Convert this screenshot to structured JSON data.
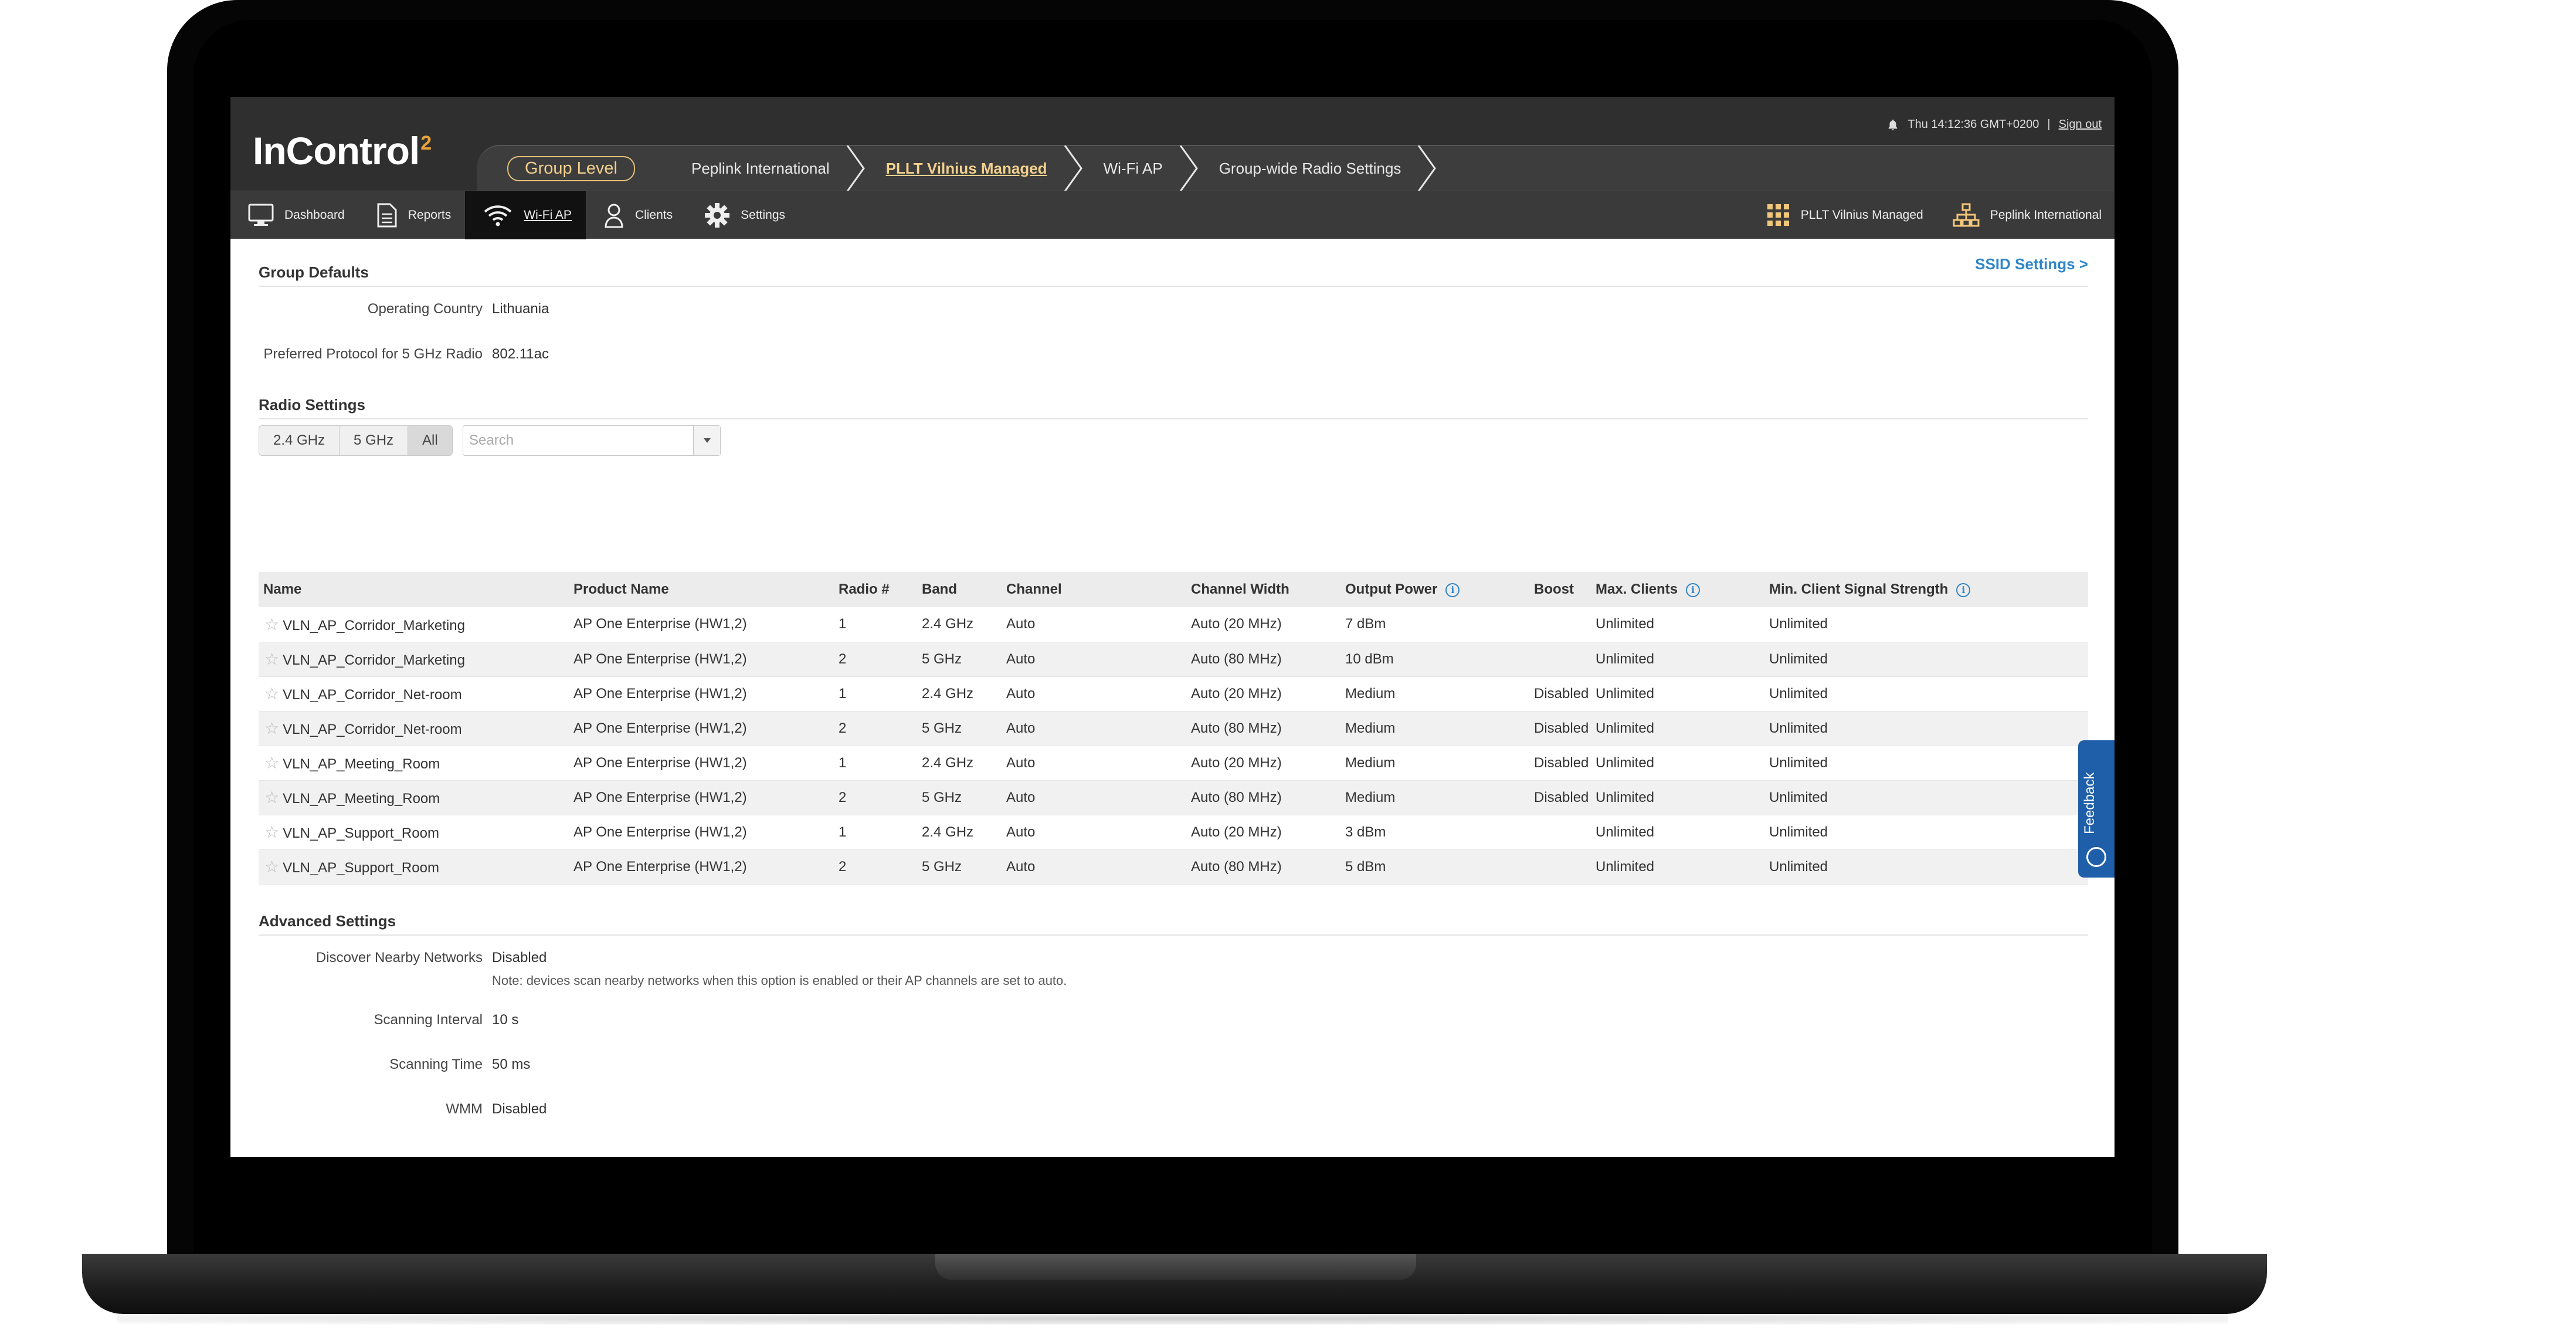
{
  "header": {
    "logo_text": "InControl",
    "logo_sup": "2",
    "datetime": "Thu 14:12:36 GMT+0200",
    "divider": "|",
    "sign_out": "Sign out"
  },
  "breadcrumb": {
    "group_level": "Group Level",
    "items": [
      "Peplink International",
      "PLLT Vilnius Managed",
      "Wi-Fi AP",
      "Group-wide Radio Settings"
    ]
  },
  "nav": {
    "items": [
      "Dashboard",
      "Reports",
      "Wi-Fi AP",
      "Clients",
      "Settings"
    ],
    "right": [
      "PLLT Vilnius Managed",
      "Peplink International"
    ]
  },
  "group_defaults": {
    "title": "Group Defaults",
    "ssid_link": "SSID Settings >",
    "operating_country_label": "Operating Country",
    "operating_country": "Lithuania",
    "preferred_protocol_label": "Preferred Protocol for 5 GHz Radio",
    "preferred_protocol": "802.11ac"
  },
  "radio_settings": {
    "title": "Radio Settings",
    "filters": [
      "2.4 GHz",
      "5 GHz",
      "All"
    ],
    "search_placeholder": "Search",
    "columns": [
      "Name",
      "Product Name",
      "Radio #",
      "Band",
      "Channel",
      "Channel Width",
      "Output Power",
      "Boost",
      "Max. Clients",
      "Min. Client Signal Strength"
    ],
    "rows": [
      [
        "VLN_AP_Corridor_Marketing",
        "AP One Enterprise (HW1,2)",
        "1",
        "2.4 GHz",
        "Auto",
        "Auto (20 MHz)",
        "7 dBm",
        "",
        "Unlimited",
        "Unlimited"
      ],
      [
        "VLN_AP_Corridor_Marketing",
        "AP One Enterprise (HW1,2)",
        "2",
        "5 GHz",
        "Auto",
        "Auto (80 MHz)",
        "10 dBm",
        "",
        "Unlimited",
        "Unlimited"
      ],
      [
        "VLN_AP_Corridor_Net-room",
        "AP One Enterprise (HW1,2)",
        "1",
        "2.4 GHz",
        "Auto",
        "Auto (20 MHz)",
        "Medium",
        "Disabled",
        "Unlimited",
        "Unlimited"
      ],
      [
        "VLN_AP_Corridor_Net-room",
        "AP One Enterprise (HW1,2)",
        "2",
        "5 GHz",
        "Auto",
        "Auto (80 MHz)",
        "Medium",
        "Disabled",
        "Unlimited",
        "Unlimited"
      ],
      [
        "VLN_AP_Meeting_Room",
        "AP One Enterprise (HW1,2)",
        "1",
        "2.4 GHz",
        "Auto",
        "Auto (20 MHz)",
        "Medium",
        "Disabled",
        "Unlimited",
        "Unlimited"
      ],
      [
        "VLN_AP_Meeting_Room",
        "AP One Enterprise (HW1,2)",
        "2",
        "5 GHz",
        "Auto",
        "Auto (80 MHz)",
        "Medium",
        "Disabled",
        "Unlimited",
        "Unlimited"
      ],
      [
        "VLN_AP_Support_Room",
        "AP One Enterprise (HW1,2)",
        "1",
        "2.4 GHz",
        "Auto",
        "Auto (20 MHz)",
        "3 dBm",
        "",
        "Unlimited",
        "Unlimited"
      ],
      [
        "VLN_AP_Support_Room",
        "AP One Enterprise (HW1,2)",
        "2",
        "5 GHz",
        "Auto",
        "Auto (80 MHz)",
        "5 dBm",
        "",
        "Unlimited",
        "Unlimited"
      ]
    ]
  },
  "advanced_settings": {
    "title": "Advanced Settings",
    "discover_label": "Discover Nearby Networks",
    "discover_value": "Disabled",
    "discover_note": "Note: devices scan nearby networks when this option is enabled or their AP channels are set to auto.",
    "scan_interval_label": "Scanning Interval",
    "scan_interval_value": "10 s",
    "scan_time_label": "Scanning Time",
    "scan_time_value": "50 ms",
    "wmm_label": "WMM",
    "wmm_value": "Disabled"
  },
  "feedback": {
    "label": "Feedback"
  },
  "colors": {
    "accent": "#2e86c9",
    "header_bg": "#2f2f2f",
    "breadcrumb_gold": "#f2d08e",
    "feedback_bg": "#1f5ea8"
  }
}
